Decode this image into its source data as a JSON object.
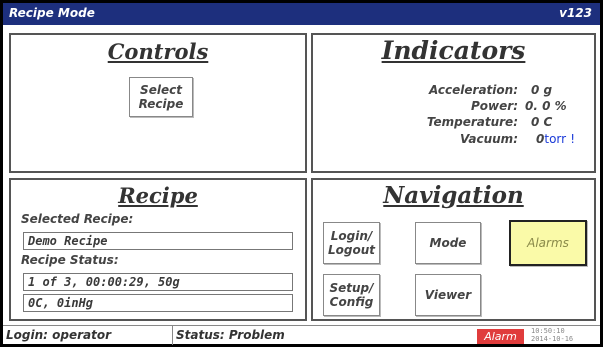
{
  "titlebar": {
    "mode": "Recipe Mode",
    "version": "v123"
  },
  "controls": {
    "title": "Controls",
    "select_recipe_label": "Select\nRecipe"
  },
  "indicators": {
    "title": "Indicators",
    "items": [
      {
        "label": "Acceleration:",
        "value": "0 g"
      },
      {
        "label": "Power:",
        "value": "0. 0 %"
      },
      {
        "label": "Temperature:",
        "value": "0 C"
      },
      {
        "label": "Vacuum:",
        "value": "0",
        "unit": "torr",
        "suffix": "!"
      }
    ]
  },
  "recipe": {
    "title": "Recipe",
    "selected_label": "Selected Recipe:",
    "selected_value": "Demo Recipe",
    "status_label": "Recipe Status:",
    "status_line1": "1 of 3, 00:00:29, 50g",
    "status_line2": "0C, 0inHg"
  },
  "navigation": {
    "title": "Navigation",
    "buttons": {
      "login": "Login/\nLogout",
      "mode": "Mode",
      "alarms": "Alarms",
      "setup": "Setup/\nConfig",
      "viewer": "Viewer"
    }
  },
  "statusbar": {
    "login": "Login: operator",
    "status": "Status: Problem",
    "alarm": "Alarm",
    "time": "10:50:10",
    "date": "2014-10-16"
  },
  "colors": {
    "titlebar": "#1d2f7d",
    "alarm_badge": "#e03c3c",
    "alarms_button": "#fafaa8"
  }
}
